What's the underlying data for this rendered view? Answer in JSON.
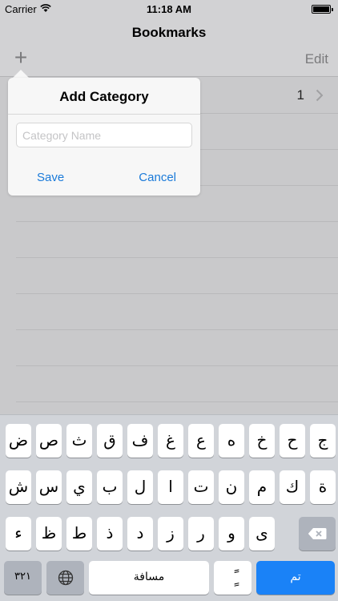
{
  "status_bar": {
    "carrier": "Carrier",
    "time": "11:18 AM",
    "wifi_icon": "wifi-icon",
    "battery_icon": "battery-icon",
    "battery_level": 1.0
  },
  "nav": {
    "title": "Bookmarks",
    "add_icon": "plus-icon",
    "add_label": "+",
    "edit_label": "Edit"
  },
  "list": {
    "rows": [
      {
        "count": "1",
        "chevron_icon": "chevron-right-icon"
      }
    ]
  },
  "popover": {
    "title": "Add Category",
    "input": {
      "placeholder": "Category Name",
      "value": ""
    },
    "save_label": "Save",
    "cancel_label": "Cancel"
  },
  "keyboard": {
    "row1": [
      "ض",
      "ص",
      "ث",
      "ق",
      "ف",
      "غ",
      "ع",
      "ه",
      "خ",
      "ح",
      "ج"
    ],
    "row2": [
      "ش",
      "س",
      "ي",
      "ب",
      "ل",
      "ا",
      "ت",
      "ن",
      "م",
      "ك",
      "ة"
    ],
    "row3": [
      "ء",
      "ظ",
      "ط",
      "ذ",
      "د",
      "ز",
      "ر",
      "و",
      "ى"
    ],
    "numbers_label": "٣٢١",
    "globe_icon": "globe-icon",
    "space_label": "مسافة",
    "tanween_label": "ًٍ",
    "done_label": "تم",
    "delete_icon": "delete-backspace-icon",
    "colors": {
      "done_key": "#1a82f7",
      "accent": "#1a7ad9"
    }
  }
}
